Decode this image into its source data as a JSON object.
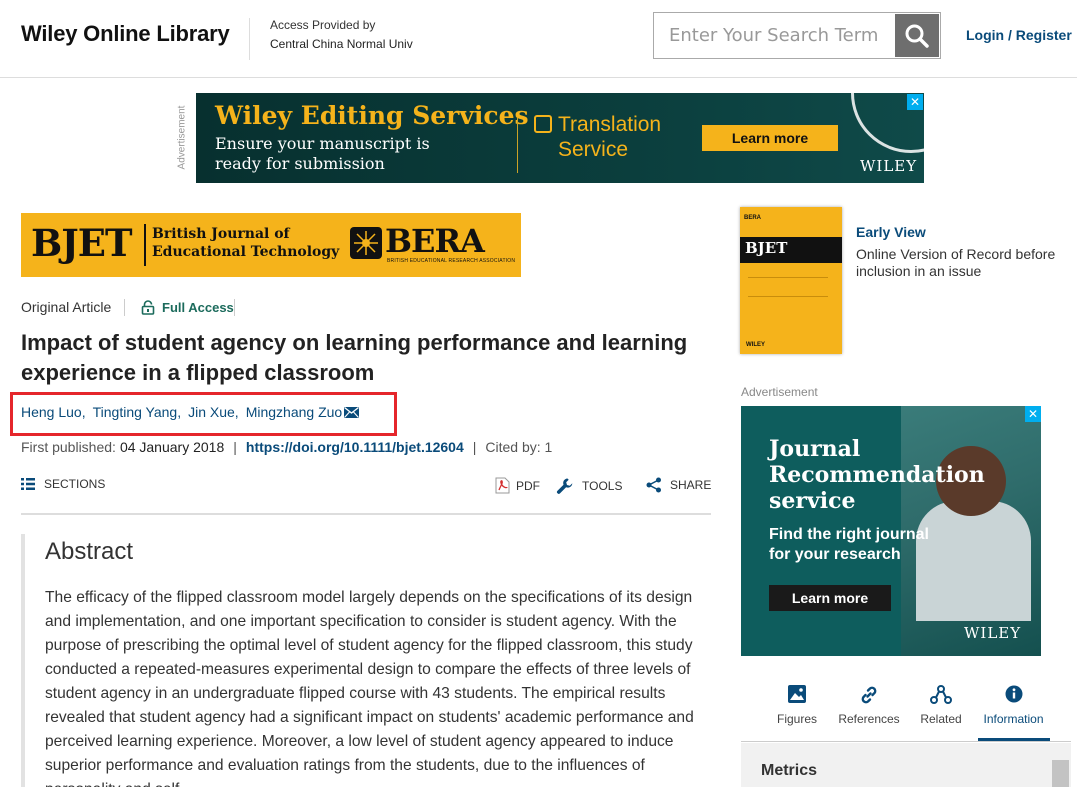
{
  "header": {
    "logo": "Wiley Online Library",
    "access_line1": "Access Provided by",
    "access_line2": "Central China Normal Univ",
    "search_placeholder": "Enter Your Search Term",
    "login_label": "Login / Register"
  },
  "top_ad": {
    "label": "Advertisement",
    "title": "Wiley Editing Services",
    "subtitle_line1": "Ensure your manuscript is",
    "subtitle_line2": "ready for submission",
    "service_line1": "Translation",
    "service_line2": "Service",
    "button": "Learn more",
    "brand": "WILEY",
    "close": "✕"
  },
  "journal_banner": {
    "abbrev": "BJET",
    "name_line1": "British Journal of",
    "name_line2": "Educational Technology",
    "partner": "BERA",
    "partner_sub": "BRITISH EDUCATIONAL RESEARCH ASSOCIATION"
  },
  "article": {
    "type": "Original Article",
    "access": "Full Access",
    "title": "Impact of student agency on learning performance and learning experience in a flipped classroom",
    "authors": [
      "Heng Luo,",
      "Tingting Yang,",
      "Jin Xue,",
      "Mingzhang Zuo"
    ],
    "first_published_label": "First published:",
    "first_published_date": "04 January 2018",
    "doi": "https://doi.org/10.1111/bjet.12604",
    "cited_by": "Cited by: 1"
  },
  "toolbar": {
    "sections": "SECTIONS",
    "pdf": "PDF",
    "tools": "TOOLS",
    "share": "SHARE"
  },
  "abstract": {
    "heading": "Abstract",
    "text": "The efficacy of the flipped classroom model largely depends on the specifications of its design and implementation, and one important specification to consider is student agency. With the purpose of prescribing the optimal level of student agency for the flipped classroom, this study conducted a repeated-measures experimental design to compare the effects of three levels of student agency in an undergraduate flipped course with 43 students. The empirical results revealed that student agency had a significant impact on students' academic performance and perceived learning experience. Moreover, a low level of student agency appeared to induce superior performance and evaluation ratings from the students, due to the influences of personality and self"
  },
  "sidebar": {
    "cover_journal": "BJET",
    "cover_partner": "BERA",
    "cover_brand": "WILEY",
    "early_view_title": "Early View",
    "early_view_desc1": "Online Version of Record before",
    "early_view_desc2": "inclusion in an issue",
    "ad_label": "Advertisement",
    "ad": {
      "title1": "Journal",
      "title2": "Recommendation",
      "title3": "service",
      "sub1": "Find the right journal",
      "sub2": "for your research",
      "button": "Learn more",
      "brand": "WILEY",
      "close": "✕"
    },
    "tabs": [
      {
        "label": "Figures",
        "icon": "image-icon"
      },
      {
        "label": "References",
        "icon": "link-icon"
      },
      {
        "label": "Related",
        "icon": "network-icon"
      },
      {
        "label": "Information",
        "icon": "info-icon"
      }
    ],
    "active_tab": "Information",
    "metrics_label": "Metrics"
  },
  "colors": {
    "brand_gold": "#f5b31b",
    "link_blue": "#0a4b7a",
    "highlight_red": "#e5262b",
    "access_green": "#1c6b5c"
  }
}
